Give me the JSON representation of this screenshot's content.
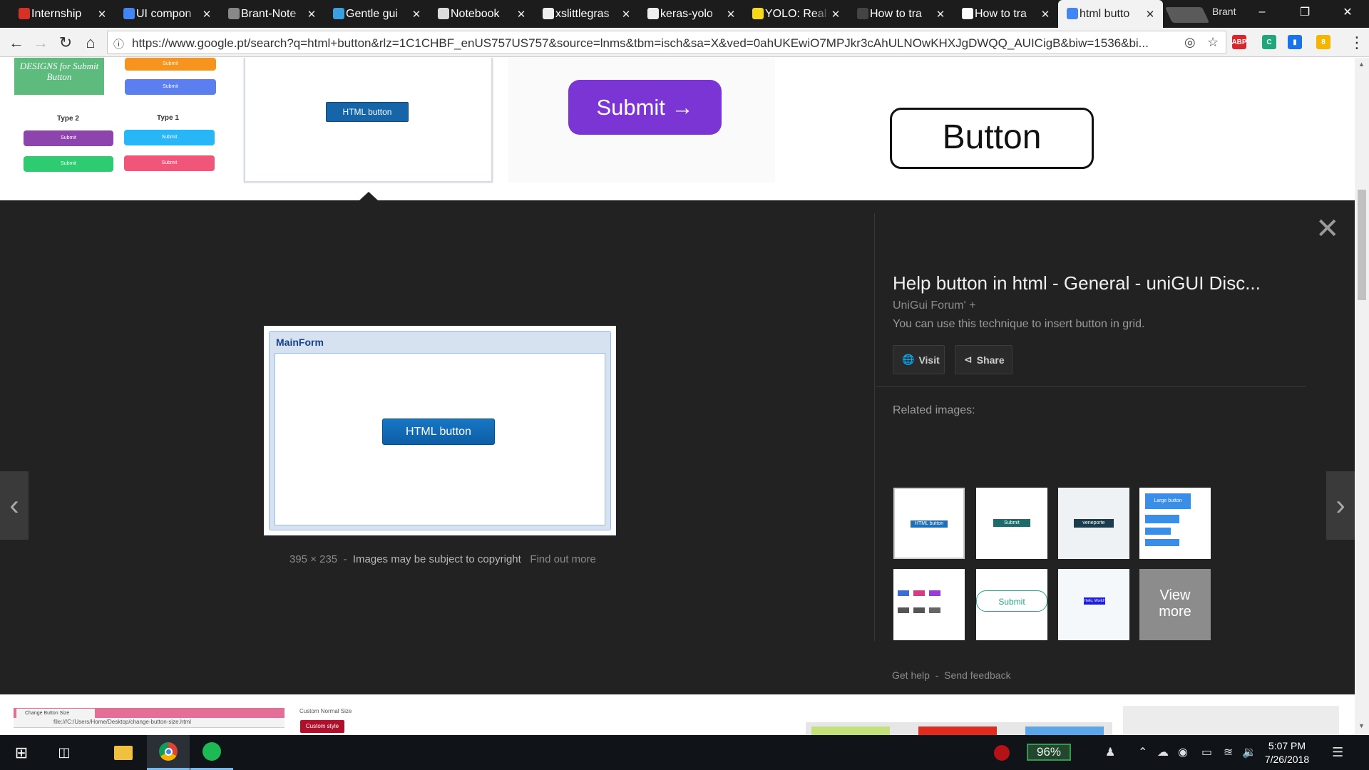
{
  "browser": {
    "tabs": [
      {
        "title": "Internship",
        "favicon_color": "#d93025",
        "favicon": "gmail-icon"
      },
      {
        "title": "UI compon",
        "favicon_color": "#4285f4",
        "favicon": "docs-icon"
      },
      {
        "title": "Brant-Note",
        "favicon_color": "#888888",
        "favicon": "gear-icon"
      },
      {
        "title": "Gentle gui",
        "favicon_color": "#3aa0e0",
        "favicon": "blog-icon"
      },
      {
        "title": "Notebook",
        "favicon_color": "#dddddd",
        "favicon": "document-icon"
      },
      {
        "title": "xslittlegras",
        "favicon_color": "#eeeeee",
        "favicon": "github-icon"
      },
      {
        "title": "keras-yolo",
        "favicon_color": "#eeeeee",
        "favicon": "github-icon"
      },
      {
        "title": "YOLO: Real",
        "favicon_color": "#f7d917",
        "favicon": "pjreddie-icon"
      },
      {
        "title": "How to tra",
        "favicon_color": "#444444",
        "favicon": "page-icon"
      },
      {
        "title": "How to tra",
        "favicon_color": "#ffffff",
        "favicon": "medium-icon"
      },
      {
        "title": "html butto",
        "favicon_color": "#4285f4",
        "favicon": "google-icon",
        "active": true
      }
    ],
    "profile_name": "Brant",
    "url": "https://www.google.pt/search?q=html+button&rlz=1C1CHBF_enUS757US757&source=lnms&tbm=isch&sa=X&ved=0ahUKEwiO7MPJkr3cAhULNOwKHXJgDWQQ_AUICigB&biw=1536&bi...",
    "extensions": [
      {
        "label": "ABP",
        "color": "#d7262c",
        "badge": "1"
      },
      {
        "label": "C",
        "color": "#21a67a"
      },
      {
        "label": "▮",
        "color": "#1a73e8"
      },
      {
        "label": "8",
        "color": "#f4b400"
      }
    ]
  },
  "top_images": {
    "design_card": {
      "ribbon": "DESIGNS for Submit Button",
      "type2_label": "Type 2",
      "type1_label": "Type 1",
      "btn_label": "Submit",
      "colors": [
        "#f7941d",
        "#5b7ff0",
        "#8e44ad",
        "#29b6f6",
        "#2ecc71",
        "#f0567a"
      ]
    },
    "htmlbtn_card_label": "HTML button",
    "submit_card_label": "Submit →",
    "button_card_label": "Button"
  },
  "preview": {
    "mainform_title": "MainForm",
    "mainform_button": "HTML button",
    "dimensions": "395 × 235",
    "copyright": "Images may be subject to copyright",
    "find_out_more": "Find out more",
    "title": "Help button in html - General - uniGUI Disc...",
    "source": "UniGui Forum' +",
    "description": "You can use this technique to insert button in grid.",
    "visit_label": "Visit",
    "share_label": "Share",
    "related_label": "Related images:",
    "related": [
      {
        "label": "HTML button"
      },
      {
        "label": "Submit"
      },
      {
        "label": "veneporte"
      },
      {
        "label": "Large button"
      },
      {
        "label": ""
      },
      {
        "label": "Submit"
      },
      {
        "label": "Hello, World!"
      },
      {
        "label": "View more"
      }
    ],
    "footer_help": "Get help",
    "footer_feedback": "Send feedback",
    "footer_sep": "-",
    "meta_sep": "-"
  },
  "bottom_strip": {
    "tab_title": "Change Button Size",
    "address": "file:///C:/Users/Home/Desktop/change-button-size.html",
    "custom_normal": "Custom Normal Size",
    "custom_style": "Custom style"
  },
  "taskbar": {
    "battery": "96%",
    "time": "5:07 PM",
    "date": "7/26/2018"
  }
}
